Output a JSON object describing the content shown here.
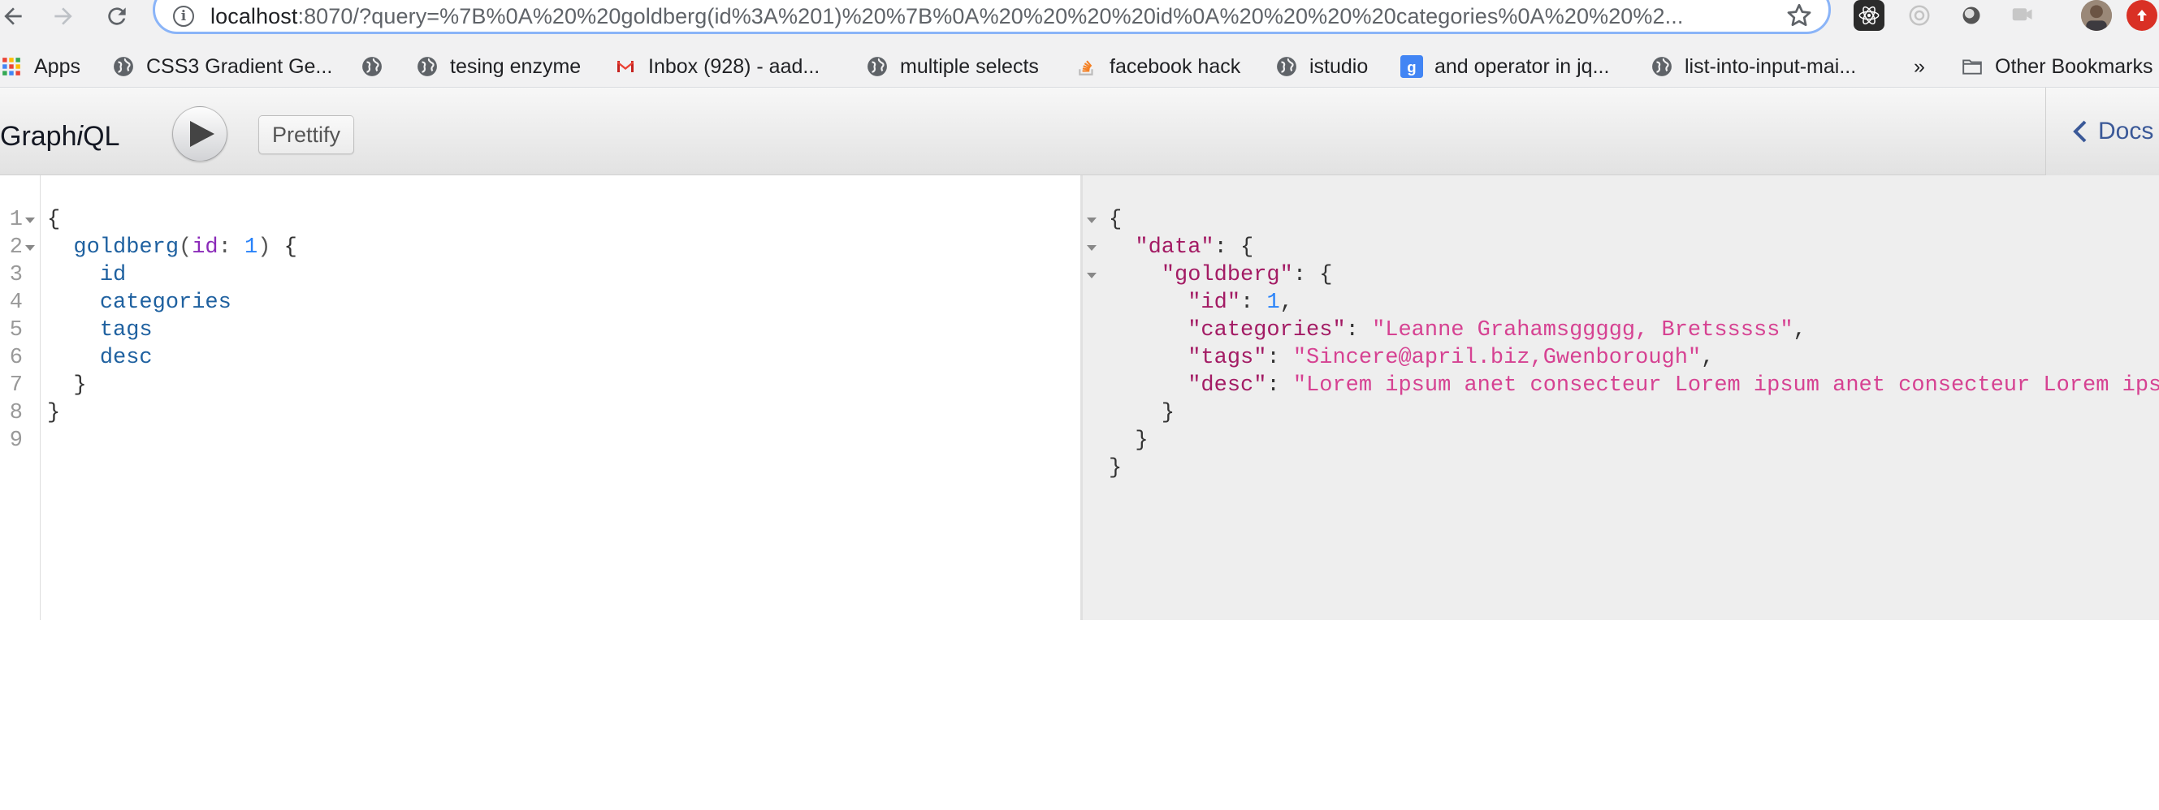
{
  "browser": {
    "url_host": "localhost",
    "url_rest": ":8070/?query=%7B%0A%20%20goldberg(id%3A%201)%20%7B%0A%20%20%20%20id%0A%20%20%20%20categories%0A%20%20%2...",
    "bookmarks": [
      {
        "label": "Apps",
        "icon": "apps-grid-icon"
      },
      {
        "label": "CSS3 Gradient Ge...",
        "icon": "globe-icon"
      },
      {
        "label": "",
        "icon": "globe-icon"
      },
      {
        "label": "tesing enzyme",
        "icon": "globe-icon"
      },
      {
        "label": "Inbox (928) - aad...",
        "icon": "gmail-icon"
      },
      {
        "label": "multiple selects",
        "icon": "globe-icon"
      },
      {
        "label": "facebook hack",
        "icon": "stack-overflow-icon"
      },
      {
        "label": "istudio",
        "icon": "globe-icon"
      },
      {
        "label": "and operator in jq...",
        "icon": "google-icon"
      },
      {
        "label": "list-into-input-mai...",
        "icon": "globe-icon"
      }
    ],
    "overflow_label": "»",
    "other_bookmarks_label": "Other Bookmarks"
  },
  "graphiql": {
    "title_prefix": "Graph",
    "title_italic": "i",
    "title_suffix": "QL",
    "prettify_label": "Prettify",
    "docs_label": "Docs"
  },
  "query_editor": {
    "line_numbers": [
      "1",
      "2",
      "3",
      "4",
      "5",
      "6",
      "7",
      "8",
      "9"
    ],
    "lines": {
      "open_brace": "{",
      "field": "goldberg",
      "paren_open": "(",
      "arg_name": "id",
      "colon": ": ",
      "arg_value": "1",
      "paren_close": ")",
      "sel_open": " {",
      "f1": "id",
      "f2": "categories",
      "f3": "tags",
      "f4": "desc",
      "inner_close": "}",
      "outer_close": "}"
    }
  },
  "result": {
    "open": "{",
    "data_key": "\"data\"",
    "goldberg_key": "\"goldberg\"",
    "id_key": "\"id\"",
    "id_value": "1",
    "categories_key": "\"categories\"",
    "categories_value": "\"Leanne Grahamsggggg, Bretsssss\"",
    "tags_key": "\"tags\"",
    "tags_value": "\"Sincere@april.biz,Gwenborough\"",
    "desc_key": "\"desc\"",
    "desc_value": "\"Lorem ipsum anet consecteur Lorem ipsum anet consecteur Lorem ipsum",
    "close_inner": "}",
    "close_data": "}",
    "close_outer": "}"
  },
  "colors": {
    "omnibox_focus": "#8ab4f8",
    "graphiql_docs": "#3b5998",
    "json_key": "#a31b64",
    "json_string": "#d64292",
    "number": "#2882f9"
  }
}
